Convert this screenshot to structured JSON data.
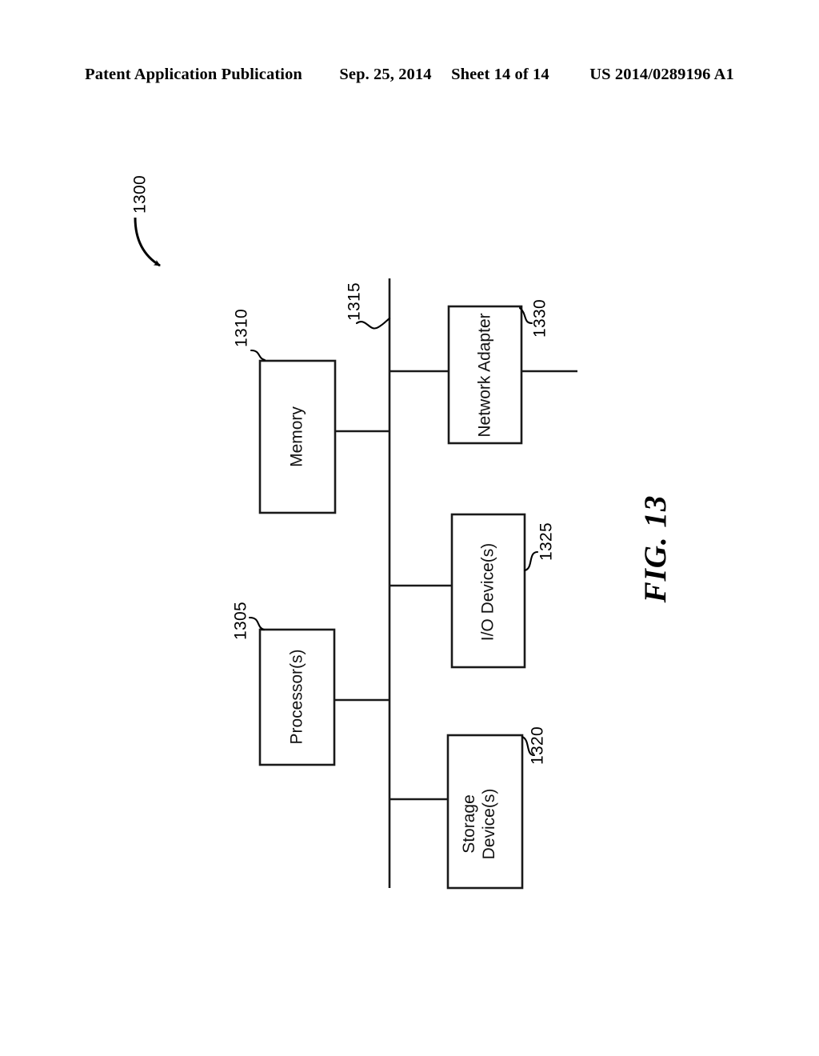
{
  "header": {
    "publication": "Patent Application Publication",
    "date": "Sep. 25, 2014",
    "sheet": "Sheet 14 of 14",
    "patent_number": "US 2014/0289196 A1"
  },
  "figure": {
    "caption": "FIG. 13",
    "system_ref": "1300",
    "bus_ref": "1315"
  },
  "blocks": [
    {
      "id": "memory",
      "label": "Memory",
      "ref": "1310"
    },
    {
      "id": "processors",
      "label": "Processor(s)",
      "ref": "1305"
    },
    {
      "id": "network-adapter",
      "label": "Network Adapter",
      "ref": "1330"
    },
    {
      "id": "io-devices",
      "label": "I/O Device(s)",
      "ref": "1325"
    },
    {
      "id": "storage-devices",
      "label_line1": "Storage",
      "label_line2": "Device(s)",
      "ref": "1320"
    }
  ],
  "colors": {
    "ink": "#000000",
    "line": "#1a1a1a",
    "background": "#ffffff"
  }
}
